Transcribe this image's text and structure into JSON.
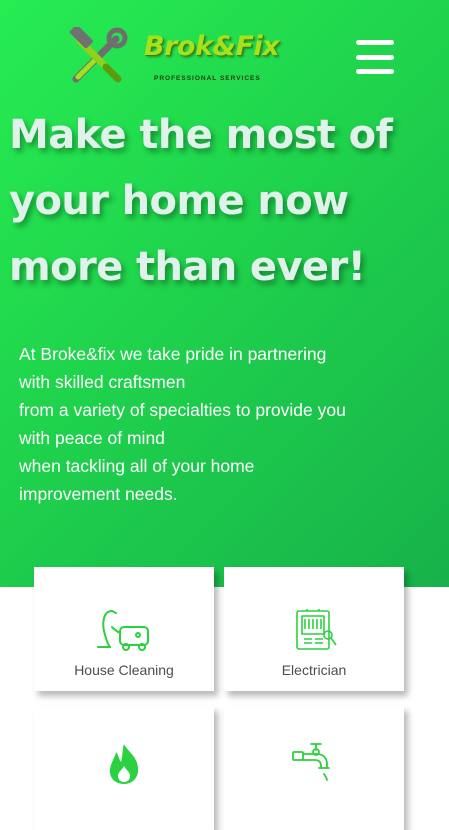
{
  "header": {
    "brand_name": "Brok&Fix",
    "brand_tagline": "PROFESSIONAL SERVICES",
    "menu_icon": "hamburger-menu-icon"
  },
  "hero": {
    "title_lines": [
      "Make the most of",
      "your home now",
      "more than ever!"
    ],
    "text_lines": [
      "At Broke&fix we take pride in partnering",
      "with skilled craftsmen",
      "from a variety of specialties to provide you",
      "with peace of mind",
      "when tackling all of your home",
      "improvement needs."
    ]
  },
  "services": [
    {
      "label": "House Cleaning",
      "icon": "vacuum-cleaner-icon"
    },
    {
      "label": "Electrician",
      "icon": "electrical-panel-icon"
    },
    {
      "label": "",
      "icon": "fire-icon"
    },
    {
      "label": "",
      "icon": "water-faucet-icon"
    }
  ],
  "colors": {
    "hero_gradient_start": "#27ec52",
    "hero_gradient_end": "#17b24a",
    "icon_green": "#2bd13e",
    "brand_lime": "#a6e21b"
  }
}
